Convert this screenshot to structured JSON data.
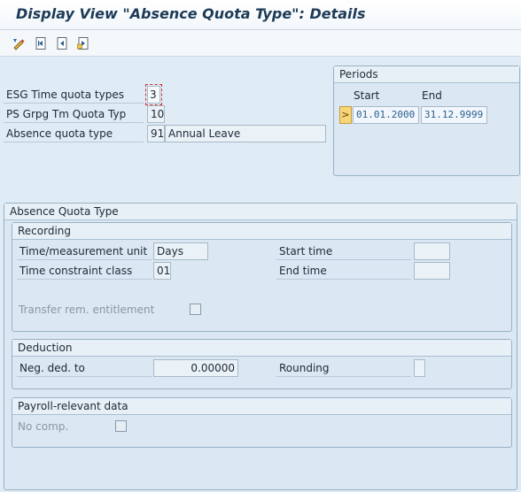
{
  "window": {
    "title": "Display View \"Absence Quota Type\": Details"
  },
  "toolbar": {
    "icons": [
      "display-change-icon",
      "first-entry-icon",
      "previous-entry-icon",
      "next-entry-icon"
    ]
  },
  "keys": {
    "esg_label": "ESG Time quota types",
    "esg_value": "3",
    "psgrp_label": "PS Grpg Tm Quota Typ",
    "psgrp_value": "10",
    "quota_label": "Absence quota type",
    "quota_value": "91",
    "quota_text": "Annual Leave"
  },
  "periods": {
    "title": "Periods",
    "start_label": "Start",
    "end_label": "End",
    "select_symbol": ">",
    "start": "01.01.2000",
    "end": "31.12.9999"
  },
  "main_group": {
    "title": "Absence Quota Type"
  },
  "recording": {
    "title": "Recording",
    "time_unit_label": "Time/measurement unit",
    "time_unit_value": "Days",
    "constraint_label": "Time constraint class",
    "constraint_value": "01",
    "start_time_label": "Start time",
    "start_time_value": "",
    "end_time_label": "End time",
    "end_time_value": "",
    "transfer_label": "Transfer rem. entitlement"
  },
  "deduction": {
    "title": "Deduction",
    "neg_label": "Neg. ded. to",
    "neg_value": "0.00000",
    "rounding_label": "Rounding",
    "rounding_value": ""
  },
  "payroll": {
    "title": "Payroll-relevant data",
    "no_comp_label": "No comp."
  },
  "colors": {
    "background": "#dfebf5",
    "title_text": "#1d3b57",
    "selection_button": "#f7d678",
    "date_text": "#2a5f8f"
  }
}
